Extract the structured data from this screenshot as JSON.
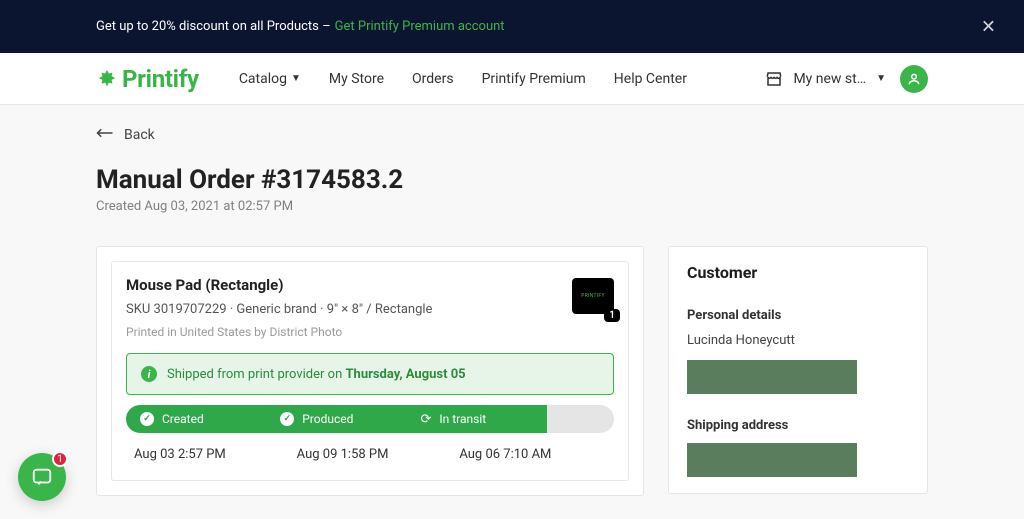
{
  "announcement": {
    "text": "Get up to 20% discount on all Products –",
    "link": "Get Printify Premium account"
  },
  "navbar": {
    "brand": "Printify",
    "links": {
      "catalog": "Catalog",
      "mystore": "My Store",
      "orders": "Orders",
      "premium": "Printify Premium",
      "help": "Help Center"
    },
    "store": "My new st…"
  },
  "back": "Back",
  "title": "Manual Order #3174583.2",
  "subtitle": "Created Aug 03, 2021 at 02:57 PM",
  "product": {
    "name": "Mouse Pad (Rectangle)",
    "meta": "SKU 3019707229  · Generic brand · 9\" × 8\" / Rectangle",
    "printed": "Printed in United States by District Photo",
    "qty": "1"
  },
  "shipbanner": {
    "prefix": "Shipped from print provider on ",
    "date": "Thursday, August 05"
  },
  "progress": {
    "created": "Created",
    "produced": "Produced",
    "transit": "In transit"
  },
  "timestamps": {
    "created": "Aug 03 2:57 PM",
    "produced": "Aug 09 1:58 PM",
    "transit": "Aug 06 7:10 AM"
  },
  "customer": {
    "title": "Customer",
    "personal_label": "Personal details",
    "name": "Lucinda Honeycutt",
    "shipping_label": "Shipping address"
  },
  "intercom": {
    "badge": "1"
  }
}
